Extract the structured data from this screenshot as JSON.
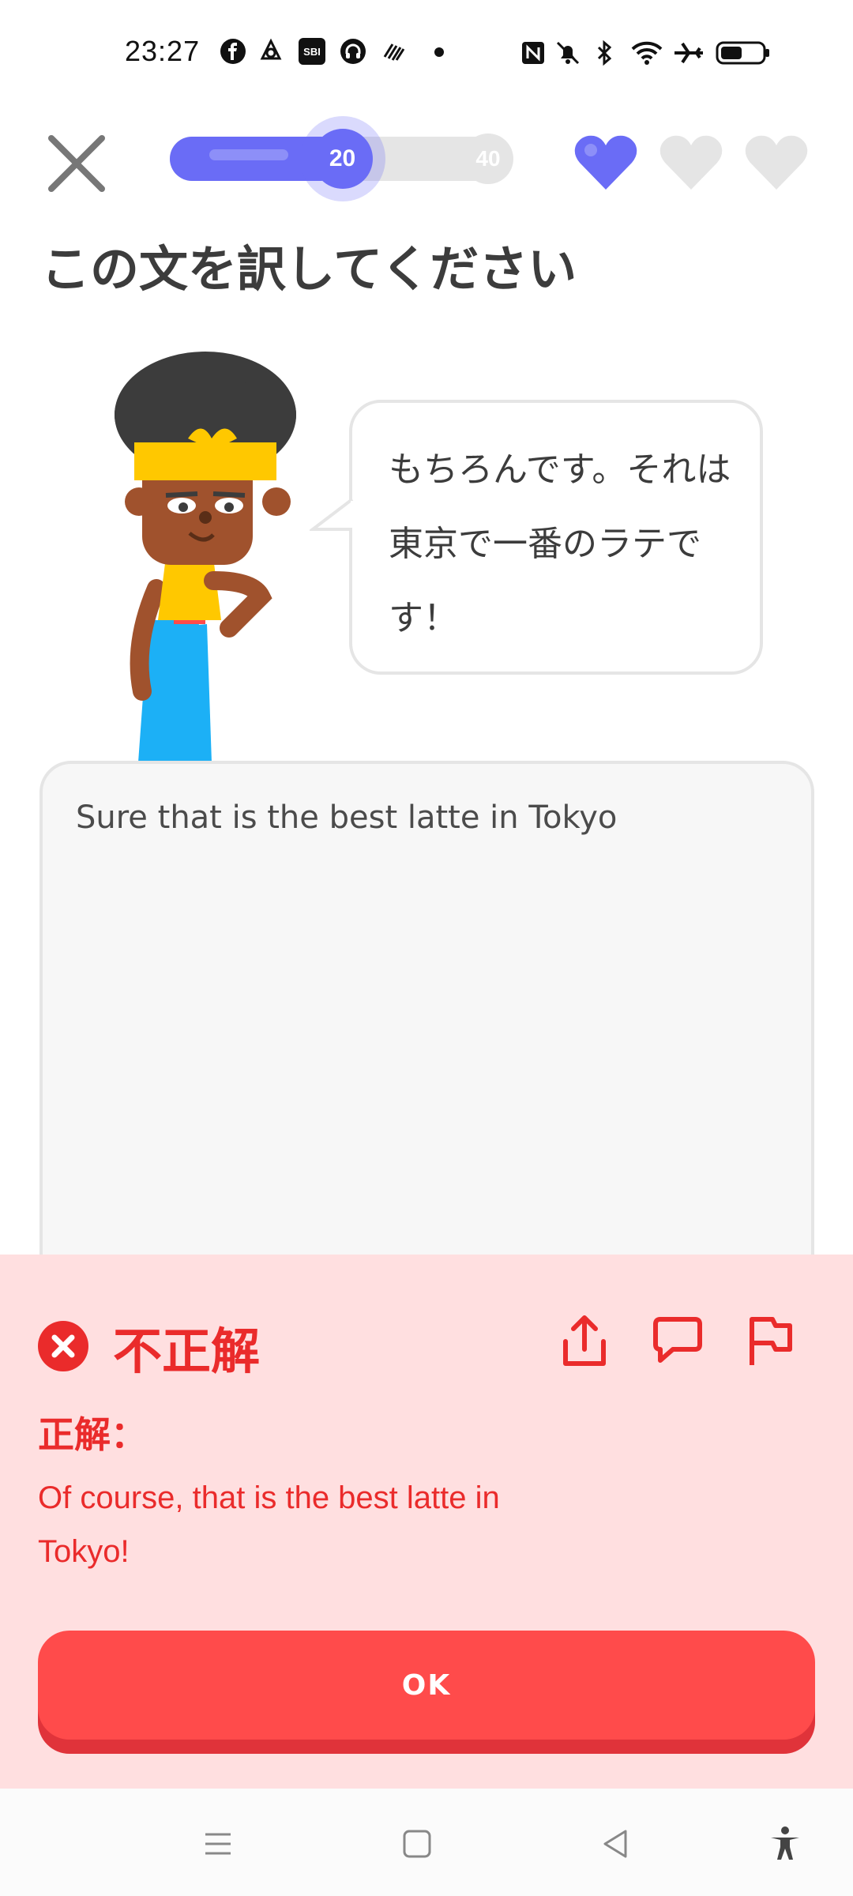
{
  "status_bar": {
    "time": "23:27",
    "left_icons": [
      "facebook-icon",
      "app-icon",
      "sbi-icon",
      "headset-icon",
      "app2-icon",
      "dot-icon"
    ],
    "right_icons": [
      "nfc-icon",
      "mute-icon",
      "bluetooth-icon",
      "wifi-icon",
      "airplane-icon",
      "battery-icon"
    ],
    "sbi_label": "SBI"
  },
  "top_bar": {
    "progress_current": "20",
    "progress_total": "40",
    "progress_fraction": 0.5,
    "hearts_filled": 1,
    "hearts_total": 3
  },
  "prompt": {
    "title": "この文を訳してください",
    "sentence": "もちろんです。それは東京で一番のラテです！"
  },
  "answer": {
    "value": "Sure that is the best latte in Tokyo"
  },
  "feedback": {
    "title": "不正解",
    "correct_label": "正解：",
    "correct_answer": "Of course, that is the best latte in Tokyo!",
    "ok_label": "OK"
  },
  "colors": {
    "accent": "#6a6cf6",
    "error": "#ea2b2b",
    "error_bg": "#ffdfe0",
    "ok_button": "#ff4b4b"
  }
}
